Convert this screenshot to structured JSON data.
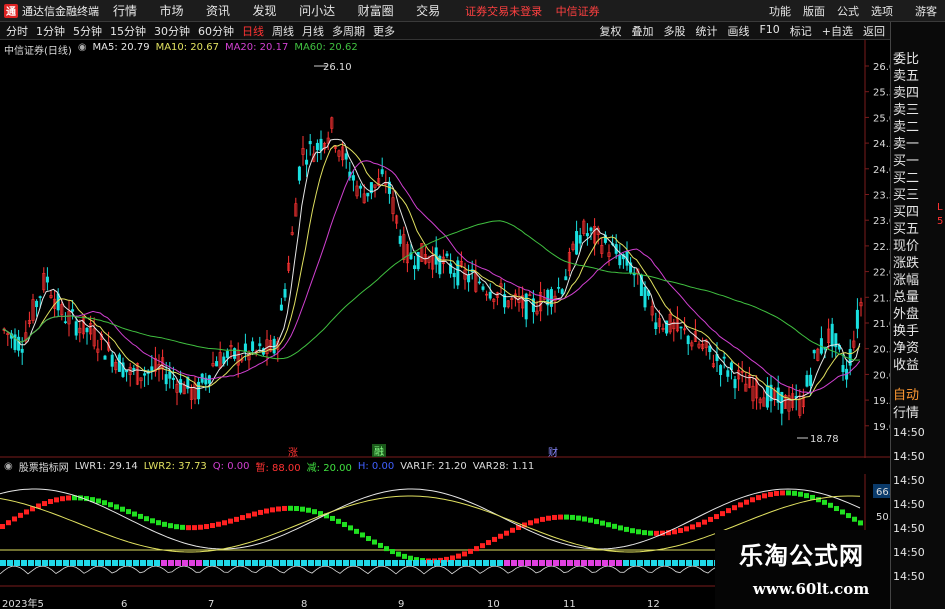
{
  "titlebar": {
    "app_title": "通达信金融终端",
    "menu": [
      "行情",
      "市场",
      "资讯",
      "发现",
      "问小达",
      "财富圈",
      "交易"
    ],
    "status": [
      "证券交易未登录",
      "中信证券"
    ],
    "right_menu": [
      "功能",
      "版面",
      "公式",
      "选项",
      "游客"
    ]
  },
  "periodbar": {
    "periods": [
      "分时",
      "1分钟",
      "5分钟",
      "15分钟",
      "30分钟",
      "60分钟",
      "日线",
      "周线",
      "月线",
      "多周期",
      "更多"
    ],
    "active": "日线",
    "tools": [
      "复权",
      "叠加",
      "多股",
      "统计",
      "画线",
      "F10",
      "标记",
      "+自选",
      "返回"
    ]
  },
  "legend": {
    "stock": "中信证券(日线)",
    "ma5": "MA5: 20.79",
    "ma10": "MA10: 20.67",
    "ma20": "MA20: 20.17",
    "ma60": "MA60: 20.62"
  },
  "price_axis": [
    "26.00",
    "25.50",
    "25.00",
    "24.50",
    "24.00",
    "23.50",
    "23.00",
    "22.50",
    "22.00",
    "21.50",
    "21.00",
    "20.50",
    "20.00",
    "19.50",
    "19.00"
  ],
  "annotations": {
    "high": "26.10",
    "low": "18.78"
  },
  "events": {
    "rise": "涨",
    "margin": "融",
    "finance": "财"
  },
  "indicator": {
    "name": "股票指标网",
    "lwr1": "LWR1: 29.14",
    "lwr2": "LWR2: 37.73",
    "q": "Q: 0.00",
    "jian": "暂: 88.00",
    "zhan": "减: 20.00",
    "h": "H: 0.00",
    "var1f": "VAR1F: 21.20",
    "var28": "VAR28: 1.11",
    "axis_value": "66.01",
    "axis_mid": "50.00"
  },
  "date_axis": [
    "2023年5",
    "6",
    "7",
    "8",
    "9",
    "10",
    "11",
    "12"
  ],
  "rightpanel": {
    "items": [
      "委比",
      "卖五",
      "卖四",
      "卖三",
      "卖二",
      "卖一",
      "买一",
      "买二",
      "买三",
      "买四",
      "买五",
      "现价",
      "涨跌",
      "涨幅",
      "总量",
      "外盘",
      "换手",
      "净资",
      "收益",
      "自动",
      "行情"
    ],
    "times": [
      "14:50",
      "14:50",
      "14:50",
      "14:50",
      "14:50",
      "14:50",
      "14:50"
    ],
    "side_labels": [
      "L",
      "5"
    ]
  },
  "watermark": {
    "title": "乐淘公式网",
    "url": "www.60lt.com"
  },
  "colors": {
    "up": "#ff3333",
    "down": "#19e0e0",
    "ma5": "#e6e6e6",
    "ma10": "#e0e060",
    "ma20": "#d040d0",
    "ma60": "#40c040"
  }
}
